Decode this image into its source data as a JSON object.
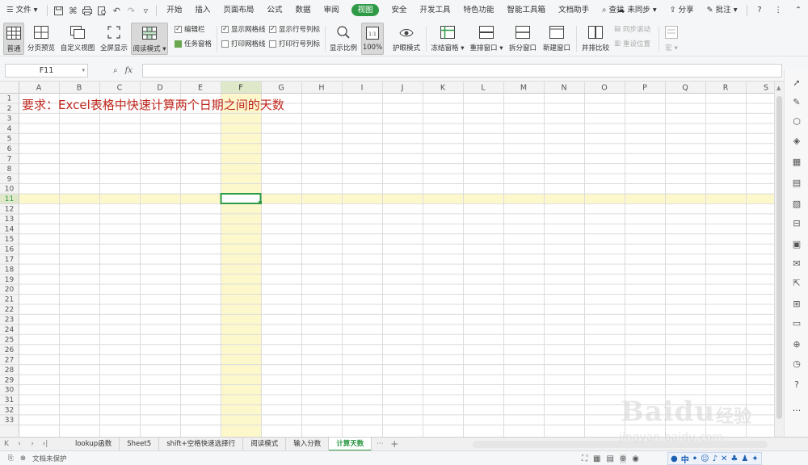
{
  "menubar": {
    "file_label": "文件",
    "menus": [
      "开始",
      "插入",
      "页面布局",
      "公式",
      "数据",
      "审阅",
      "视图",
      "安全",
      "开发工具",
      "特色功能",
      "智能工具箱",
      "文档助手"
    ],
    "active_menu": "视图",
    "search_label": "查找",
    "sync_label": "未同步",
    "share_label": "分享",
    "comment_label": "批注"
  },
  "ribbon": {
    "normal": "普通",
    "page_break_preview": "分页预览",
    "custom_view": "自定义视图",
    "full_screen": "全屏显示",
    "reading_mode": "阅读模式",
    "edit_bar": "编辑栏",
    "task_pane": "任务窗格",
    "show_gridlines": "显示网格线",
    "print_gridlines": "打印网格线",
    "show_headers": "显示行号列标",
    "print_headers": "打印行号列标",
    "zoom": "显示比例",
    "zoom_100": "100%",
    "eye_protection": "护眼模式",
    "freeze_panes": "冻结窗格",
    "rearrange": "重排窗口",
    "split": "拆分窗口",
    "new_window": "新建窗口",
    "side_by_side": "并排比较",
    "sync_scroll": "同步滚动",
    "reset_position": "重设位置",
    "macro": "宏"
  },
  "formula_bar": {
    "name_box": "F11",
    "formula": ""
  },
  "grid": {
    "columns": [
      "A",
      "B",
      "C",
      "D",
      "E",
      "F",
      "G",
      "H",
      "I",
      "J",
      "K",
      "L",
      "M",
      "N",
      "O",
      "P",
      "Q",
      "R",
      "S"
    ],
    "row_count": 33,
    "selected_col": "F",
    "selected_row": 11,
    "a1_text": "要求：Excel表格中快速计算两个日期之间的天数"
  },
  "sheets": {
    "tabs": [
      "lookup函数",
      "Sheet5",
      "shift+空格快速选择行",
      "阅读模式",
      "输入分数",
      "计算天数"
    ],
    "active": "计算天数",
    "more": "···",
    "add": "+"
  },
  "status": {
    "protection": "文档未保护"
  },
  "ime": {
    "label": "中"
  },
  "watermark": {
    "logo": "Baidu",
    "cn": "经验",
    "url": "jingyan.baidu.com"
  },
  "colors": {
    "accent_green": "#2e9a46",
    "highlight_yellow": "#fdf8cc",
    "title_red": "#c0281e"
  }
}
